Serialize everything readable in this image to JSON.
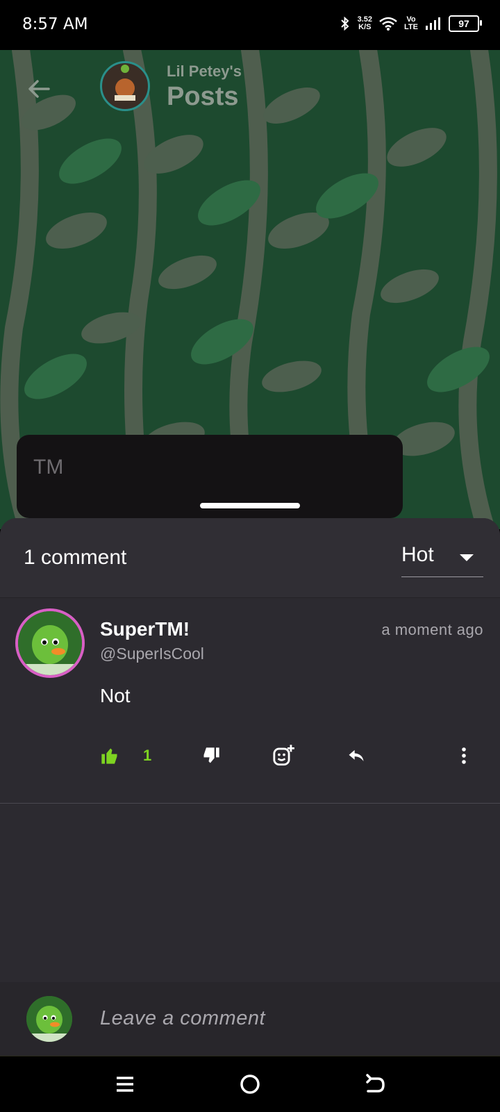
{
  "status_bar": {
    "time": "8:57 AM",
    "speed_value": "3.52",
    "speed_unit": "K/S",
    "volte_top": "Vo",
    "volte_bottom": "LTE",
    "battery": "97"
  },
  "header": {
    "subtitle": "Lil Petey's",
    "title": "Posts"
  },
  "composer": {
    "text": "TM"
  },
  "comments_sheet": {
    "count_label": "1 comment",
    "sort_label": "Hot"
  },
  "comments": [
    {
      "name": "SuperTM!",
      "handle": "@SuperIsCool",
      "time": "a moment ago",
      "body": "Not",
      "likes": "1"
    }
  ],
  "footer": {
    "placeholder": "Leave a comment"
  },
  "colors": {
    "accent_green": "#7ed321",
    "sheet_bg": "#2c2a30",
    "avatar_ring": "#d85fc5"
  }
}
